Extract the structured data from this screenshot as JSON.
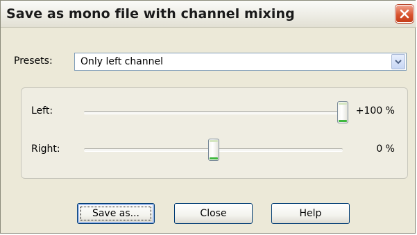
{
  "window": {
    "title": "Save as mono file with channel mixing"
  },
  "presets": {
    "label": "Presets:",
    "selected": "Only left channel"
  },
  "channels": [
    {
      "label": "Left:",
      "value_text": "+100 %",
      "level_percent": 100
    },
    {
      "label": "Right:",
      "value_text": "0 %",
      "level_percent": 0
    }
  ],
  "buttons": {
    "save_as": "Save as...",
    "close": "Close",
    "help": "Help"
  },
  "icons": {
    "close": "close-icon",
    "dropdown": "chevron-down-icon"
  },
  "colors": {
    "dialog_bg": "#ece9d8",
    "close_button": "#d9542f",
    "thumb_accent": "#3fb83f"
  }
}
